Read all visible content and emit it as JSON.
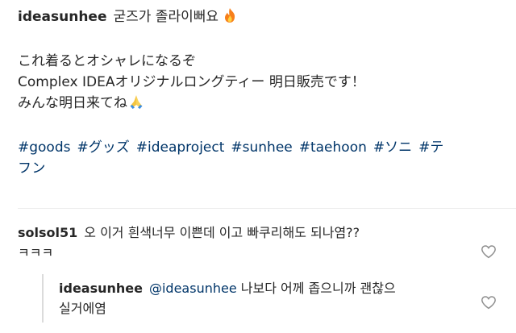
{
  "post": {
    "username": "ideasunhee",
    "caption_line1": "굳즈가 졸라이뻐요",
    "caption_line2": "これ着るとオシャレになるぞ",
    "caption_line3": "Complex IDEAオリジナルロングティー 明日販売です！",
    "caption_line4": "みんな明日来てね",
    "hashtags": [
      "#goods",
      "#グッズ",
      "#ideaproject",
      "#sunhee",
      "#taehoon",
      "#ソニ",
      "#テ"
    ],
    "hashtag_wrap": "フン",
    "fire_emoji": "fire-emoji-icon",
    "pray_emoji": "folded-hands-emoji-icon"
  },
  "comments": [
    {
      "username": "solsol51",
      "text": "오 이거 흰색너무 이쁜데 이고 빠쿠리해도 되나염??",
      "text_wrap": "ㅋㅋㅋ",
      "like_icon": "heart-outline-icon"
    },
    {
      "username": "ideasunhee",
      "mention": "@ideasunhee",
      "text": "나보다 어께 좁으니까 괜찮으",
      "text_wrap": "실거에염",
      "like_icon": "heart-outline-icon"
    }
  ],
  "colors": {
    "text": "#262626",
    "link": "#003569",
    "divider": "#ededed"
  }
}
